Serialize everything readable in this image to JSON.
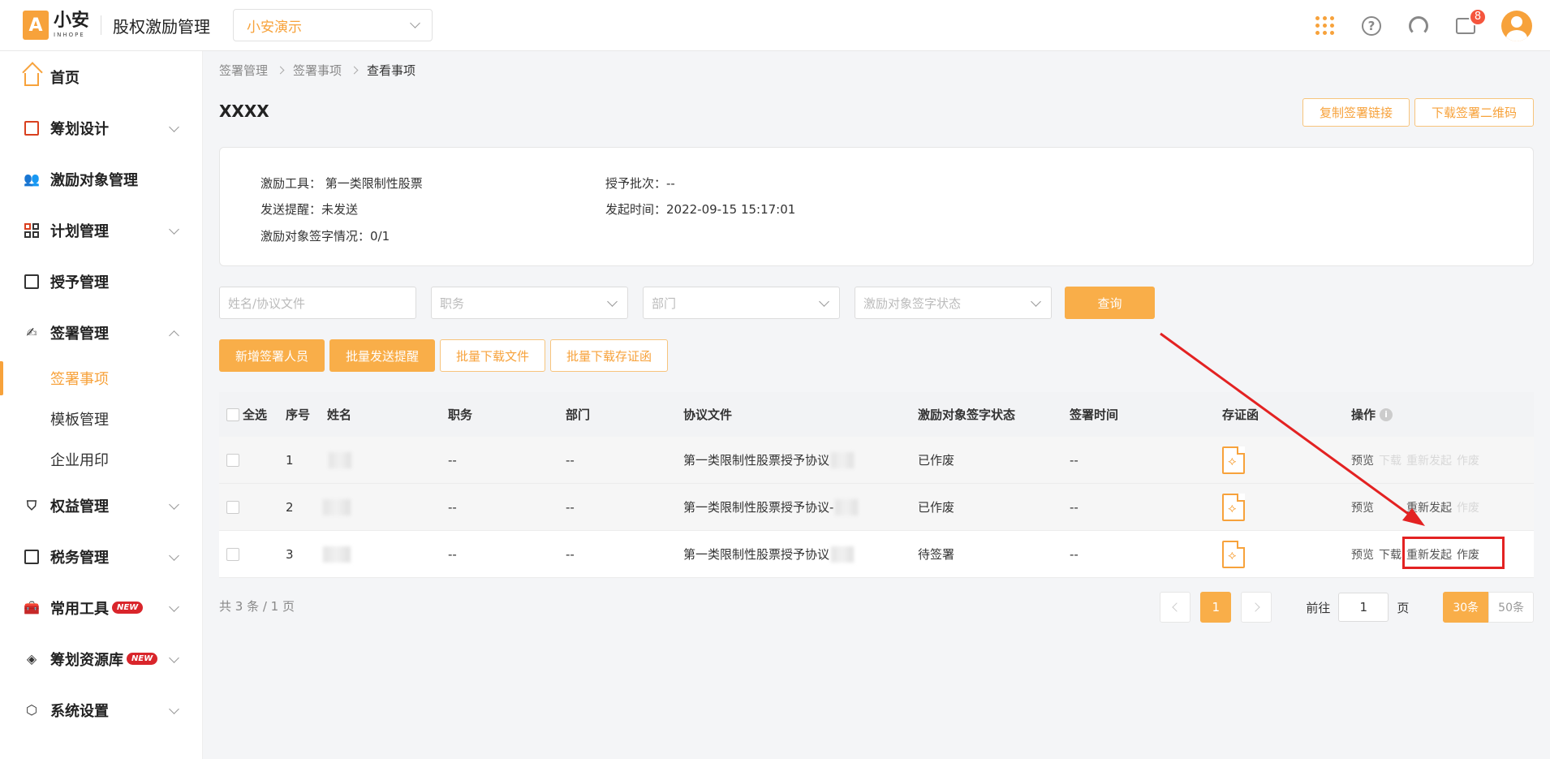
{
  "header": {
    "logo_text": "小安",
    "logo_sub": "INHOPE",
    "app_title": "股权激励管理",
    "company": "小安演示",
    "notification_count": "8"
  },
  "sidebar": {
    "items": [
      {
        "label": "首页"
      },
      {
        "label": "筹划设计"
      },
      {
        "label": "激励对象管理"
      },
      {
        "label": "计划管理"
      },
      {
        "label": "授予管理"
      },
      {
        "label": "签署管理"
      },
      {
        "label": "权益管理"
      },
      {
        "label": "税务管理"
      },
      {
        "label": "常用工具",
        "tag": "NEW"
      },
      {
        "label": "筹划资源库",
        "tag": "NEW"
      },
      {
        "label": "系统设置"
      }
    ],
    "sub_items": [
      "签署事项",
      "模板管理",
      "企业用印"
    ]
  },
  "breadcrumb": [
    "签署管理",
    "签署事项",
    "查看事项"
  ],
  "page_title": "XXXX",
  "top_buttons": {
    "copy_link": "复制签署链接",
    "download_qr": "下载签署二维码"
  },
  "info": {
    "tool": "激励工具：  第一类限制性股票",
    "batch": "授予批次：--",
    "reminder": "发送提醒：未发送",
    "start_time": "发起时间：2022-09-15 15:17:01",
    "sign_status": "激励对象签字情况：0/1"
  },
  "filters": {
    "name_placeholder": "姓名/协议文件",
    "position_placeholder": "职务",
    "dept_placeholder": "部门",
    "status_placeholder": "激励对象签字状态",
    "query": "查询"
  },
  "actions": {
    "add_signer": "新增签署人员",
    "batch_remind": "批量发送提醒",
    "batch_download": "批量下载文件",
    "batch_download_cert": "批量下载存证函"
  },
  "table": {
    "headers": {
      "select_all": "全选",
      "index": "序号",
      "name": "姓名",
      "position": "职务",
      "dept": "部门",
      "agreement": "协议文件",
      "status": "激励对象签字状态",
      "sign_time": "签署时间",
      "cert": "存证函",
      "ops": "操作"
    },
    "rows": [
      {
        "index": "1",
        "position": "--",
        "dept": "--",
        "agreement": "第一类限制性股票授予协议",
        "status": "已作废",
        "sign_time": "--"
      },
      {
        "index": "2",
        "position": "--",
        "dept": "--",
        "agreement": "第一类限制性股票授予协议-",
        "status": "已作废",
        "sign_time": "--"
      },
      {
        "index": "3",
        "position": "--",
        "dept": "--",
        "agreement": "第一类限制性股票授予协议",
        "status": "待签署",
        "sign_time": "--"
      }
    ],
    "ops": {
      "preview": "预览",
      "download": "下载",
      "reinitiate": "重新发起",
      "void": "作废"
    }
  },
  "footer": {
    "total": "共 3 条 / 1 页",
    "current_page": "1",
    "goto_label": "前往",
    "goto_value": "1",
    "page_unit": "页",
    "size_30": "30条",
    "size_50": "50条"
  },
  "colors": {
    "accent": "#f7a23b",
    "annotation": "#e32222"
  }
}
